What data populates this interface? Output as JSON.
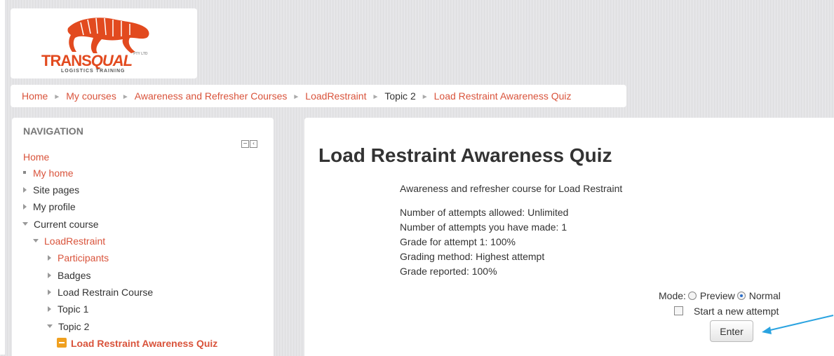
{
  "logo": {
    "brand_part1": "TRANS",
    "brand_part2": "QUAL",
    "tagline": "LOGISTICS TRAINING",
    "suffix": "PTY LTD",
    "brand_color": "#e24a1f"
  },
  "breadcrumb": {
    "items": [
      {
        "label": "Home",
        "link": true
      },
      {
        "label": "My courses",
        "link": true
      },
      {
        "label": "Awareness and Refresher Courses",
        "link": true
      },
      {
        "label": "LoadRestraint",
        "link": true
      },
      {
        "label": "Topic 2",
        "link": false
      },
      {
        "label": "Load Restraint Awareness Quiz",
        "link": true
      }
    ],
    "separator": "►"
  },
  "navigation": {
    "title": "NAVIGATION",
    "items": [
      {
        "label": "Home"
      },
      {
        "label": "My home"
      },
      {
        "label": "Site pages"
      },
      {
        "label": "My profile"
      },
      {
        "label": "Current course"
      },
      {
        "label": "LoadRestraint"
      },
      {
        "label": "Participants"
      },
      {
        "label": "Badges"
      },
      {
        "label": "Load Restrain Course"
      },
      {
        "label": "Topic 1"
      },
      {
        "label": "Topic 2"
      },
      {
        "label": "Load Restraint Awareness Quiz"
      }
    ]
  },
  "quiz": {
    "title": "Load Restraint Awareness Quiz",
    "intro": "Awareness and refresher course for Load Restraint",
    "info": [
      "Number of attempts allowed: Unlimited",
      "Number of attempts you have made: 1",
      "Grade for attempt 1: 100%",
      "Grading method: Highest attempt",
      "Grade reported: 100%"
    ],
    "mode_label": "Mode:",
    "mode_preview": "Preview",
    "mode_normal": "Normal",
    "mode_selected": "Normal",
    "new_attempt_label": "Start a new attempt",
    "new_attempt_checked": false,
    "enter_label": "Enter"
  },
  "colors": {
    "link": "#d9533b",
    "annotation_arrow": "#2aa3e0"
  }
}
